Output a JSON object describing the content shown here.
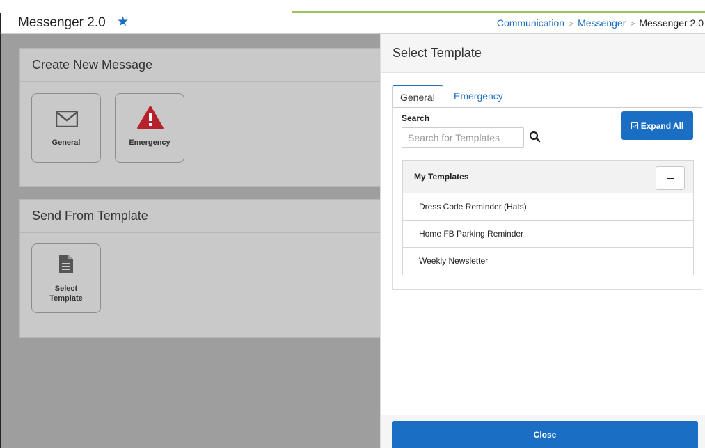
{
  "header": {
    "title": "Messenger 2.0",
    "breadcrumb": [
      "Communication",
      "Messenger",
      "Messenger 2.0"
    ]
  },
  "create_card": {
    "title": "Create New Message",
    "tiles": [
      {
        "label": "General",
        "icon": "envelope-icon"
      },
      {
        "label": "Emergency",
        "icon": "warning-icon"
      }
    ]
  },
  "template_card": {
    "title": "Send From Template",
    "tile": {
      "label_line1": "Select",
      "label_line2": "Template",
      "icon": "document-icon"
    }
  },
  "panel": {
    "title": "Select Template",
    "tabs": [
      {
        "label": "General",
        "active": true
      },
      {
        "label": "Emergency",
        "active": false
      }
    ],
    "search": {
      "label": "Search",
      "placeholder": "Search for Templates"
    },
    "expand_all_label": "Expand All",
    "group": {
      "title": "My Templates",
      "items": [
        "Dress Code Reminder (Hats)",
        "Home FB Parking Reminder",
        "Weekly Newsletter"
      ]
    },
    "close_label": "Close"
  },
  "colors": {
    "primary": "#1a6fc4",
    "emergency": "#b5222b",
    "overlay": "#9e9e9e"
  }
}
